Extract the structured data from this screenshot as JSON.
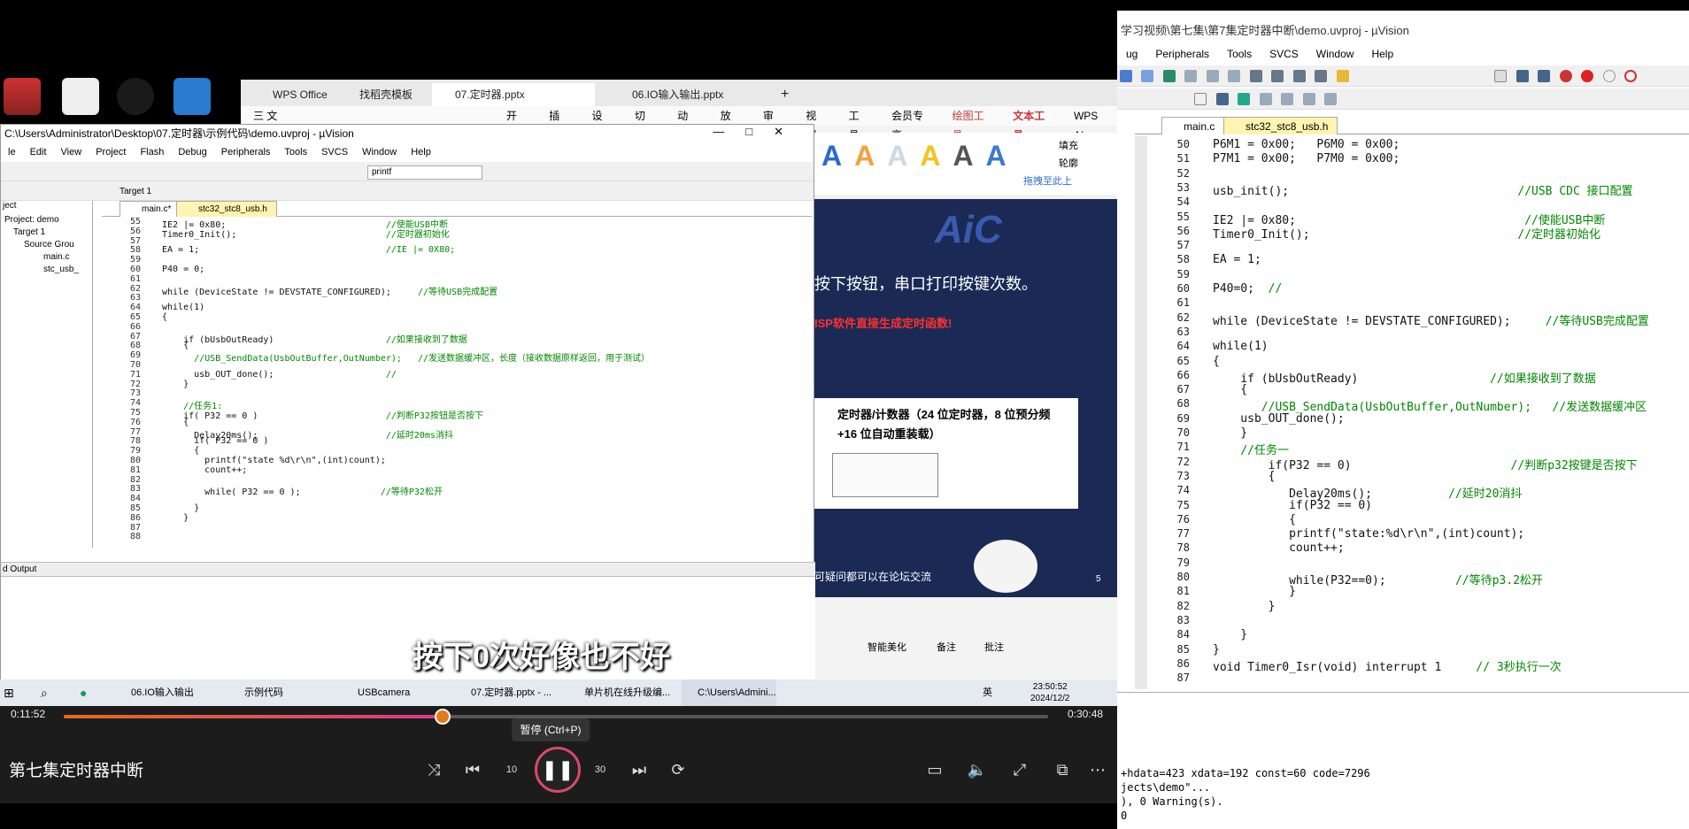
{
  "right_window": {
    "title": "学习视频\\第七集\\第7集定时器中断\\demo.uvproj - µVision",
    "menu": [
      "ug",
      "Peripherals",
      "Tools",
      "SVCS",
      "Window",
      "Help"
    ],
    "tabs": [
      "main.c",
      "stc32_stc8_usb.h"
    ],
    "lines": [
      {
        "n": "50",
        "t": "P6M1 = 0x00;   P6M0 = 0x00;"
      },
      {
        "n": "51",
        "t": "P7M1 = 0x00;   P7M0 = 0x00;"
      },
      {
        "n": "52",
        "t": ""
      },
      {
        "n": "53",
        "t": "usb_init();                                 //USB CDC 接口配置"
      },
      {
        "n": "54",
        "t": ""
      },
      {
        "n": "55",
        "t": "IE2 |= 0x80;                                 //使能USB中断"
      },
      {
        "n": "56",
        "t": "Timer0_Init();                              //定时器初始化"
      },
      {
        "n": "57",
        "t": ""
      },
      {
        "n": "58",
        "t": "EA = 1;"
      },
      {
        "n": "59",
        "t": ""
      },
      {
        "n": "60",
        "t": "P40=0;  //"
      },
      {
        "n": "61",
        "t": ""
      },
      {
        "n": "62",
        "t": "while (DeviceState != DEVSTATE_CONFIGURED);     //等待USB完成配置"
      },
      {
        "n": "63",
        "t": ""
      },
      {
        "n": "64",
        "t": "while(1)"
      },
      {
        "n": "65",
        "t": "{"
      },
      {
        "n": "66",
        "t": "    if (bUsbOutReady)                   //如果接收到了数据"
      },
      {
        "n": "67",
        "t": "    {"
      },
      {
        "n": "68",
        "t": "       //USB_SendData(UsbOutBuffer,OutNumber);   //发送数据缓冲区"
      },
      {
        "n": "69",
        "t": "    usb_OUT_done();"
      },
      {
        "n": "70",
        "t": "    }"
      },
      {
        "n": "71",
        "t": "    //任务一"
      },
      {
        "n": "72",
        "t": "        if(P32 == 0)                       //判断p32按键是否按下"
      },
      {
        "n": "73",
        "t": "        {"
      },
      {
        "n": "74",
        "t": "           Delay20ms();           //延时20消抖"
      },
      {
        "n": "75",
        "t": "           if(P32 == 0)"
      },
      {
        "n": "76",
        "t": "           {"
      },
      {
        "n": "77",
        "t": "           printf(\"state:%d\\r\\n\",(int)count);"
      },
      {
        "n": "78",
        "t": "           count++;"
      },
      {
        "n": "79",
        "t": ""
      },
      {
        "n": "80",
        "t": "           while(P32==0);          //等待p3.2松开"
      },
      {
        "n": "81",
        "t": "           }"
      },
      {
        "n": "82",
        "t": "        }"
      },
      {
        "n": "83",
        "t": ""
      },
      {
        "n": "84",
        "t": "    }"
      },
      {
        "n": "85",
        "t": "}"
      },
      {
        "n": "86",
        "t": "void Timer0_Isr(void) interrupt 1     // 3秒执行一次"
      },
      {
        "n": "87",
        "t": ""
      }
    ],
    "output": [
      "+hdata=423 xdata=192 const=60 code=7296",
      "jects\\demo\"...",
      "), 0 Warning(s).",
      "0"
    ]
  },
  "wps": {
    "tabs": [
      "WPS Office",
      "找稻壳模板",
      "07.定时器.pptx",
      "06.IO输入输出.pptx"
    ],
    "ribbon": [
      "三 文件",
      "开始",
      "插入",
      "设计",
      "切换",
      "动画",
      "放映",
      "审阅",
      "视图",
      "工具",
      "会员专享",
      "绘图工具",
      "文本工具",
      "WPS AI"
    ],
    "style_letters": [
      "A",
      "A",
      "A",
      "A",
      "A",
      "A"
    ],
    "slide_text1": "按下按钮，串口打印按键次数。",
    "slide_text2": "ISP软件直接生成定时函数!",
    "slide_box1": "定时器/计数器（24 位定时器，8 位预分频",
    "slide_box2": "+16 位自动重装载）",
    "slide_footer": "可疑问都可以在论坛交流",
    "slide_num": "5",
    "status": [
      "智能美化",
      "备注",
      "批注"
    ],
    "float_btn": "拖拽至此上",
    "style_fill": "填充",
    "style_outline": "轮廓"
  },
  "inner_window": {
    "title": "C:\\Users\\Administrator\\Desktop\\07.定时器\\示例代码\\demo.uvproj - µVision",
    "menu": [
      "le",
      "Edit",
      "View",
      "Project",
      "Flash",
      "Debug",
      "Peripherals",
      "Tools",
      "SVCS",
      "Window",
      "Help"
    ],
    "target": "Target 1",
    "find": "printf",
    "tabs": [
      "main.c*",
      "stc32_stc8_usb.h"
    ],
    "project": [
      "ject",
      "Project: demo",
      "Target 1",
      "Source Grou",
      "main.c",
      "stc_usb_"
    ],
    "lines": [
      {
        "n": "55",
        "t": "IE2 |= 0x80;                              //使能USB中断"
      },
      {
        "n": "56",
        "t": "Timer0_Init();                            //定时器初始化"
      },
      {
        "n": "57",
        "t": ""
      },
      {
        "n": "58",
        "t": "EA = 1;                                   //IE |= 0X80;"
      },
      {
        "n": "59",
        "t": ""
      },
      {
        "n": "60",
        "t": "P40 = 0;"
      },
      {
        "n": "61",
        "t": ""
      },
      {
        "n": "62",
        "t": "while (DeviceState != DEVSTATE_CONFIGURED);     //等待USB完成配置"
      },
      {
        "n": "63",
        "t": ""
      },
      {
        "n": "64",
        "t": "while(1)"
      },
      {
        "n": "65",
        "t": "{"
      },
      {
        "n": "66",
        "t": ""
      },
      {
        "n": "67",
        "t": "    if (bUsbOutReady)                     //如果接收到了数据"
      },
      {
        "n": "68",
        "t": "    {"
      },
      {
        "n": "69",
        "t": "      //USB_SendData(UsbOutBuffer,OutNumber);   //发送数据缓冲区，长度（接收数据原样返回，用于测试）"
      },
      {
        "n": "70",
        "t": ""
      },
      {
        "n": "71",
        "t": "      usb_OUT_done();                     //"
      },
      {
        "n": "72",
        "t": "    }"
      },
      {
        "n": "73",
        "t": ""
      },
      {
        "n": "74",
        "t": "    //任务1:"
      },
      {
        "n": "75",
        "t": "    if( P32 == 0 )                        //判断P32按钮是否按下"
      },
      {
        "n": "76",
        "t": "    {"
      },
      {
        "n": "77",
        "t": "      Delay20ms();                        //延时20ms消抖"
      },
      {
        "n": "78",
        "t": "      if( P32 == 0 )"
      },
      {
        "n": "79",
        "t": "      {"
      },
      {
        "n": "80",
        "t": "        printf(\"state %d\\r\\n\",(int)count);"
      },
      {
        "n": "81",
        "t": "        count++;"
      },
      {
        "n": "82",
        "t": ""
      },
      {
        "n": "83",
        "t": "        while( P32 == 0 );               //等待P32松开"
      },
      {
        "n": "84",
        "t": ""
      },
      {
        "n": "85",
        "t": "      }"
      },
      {
        "n": "86",
        "t": "    }"
      },
      {
        "n": "87",
        "t": ""
      },
      {
        "n": "88",
        "t": ""
      }
    ],
    "build_output": "d Output"
  },
  "taskbar": {
    "items": [
      "06.IO输入输出",
      "示例代码",
      "USBcamera",
      "07.定时器.pptx - ...",
      "单片机在线升级编...",
      "C:\\Users\\Admini..."
    ],
    "ime": "英",
    "time": "23:50:52",
    "date": "2024/12/2"
  },
  "player": {
    "current": "0:11:52",
    "total": "0:30:48",
    "progress": 0.385,
    "tooltip": "暂停 (Ctrl+P)",
    "title": "第七集定时器中断",
    "subtitle": "按下0次好像也不好",
    "rewind": "10",
    "forward": "30"
  }
}
